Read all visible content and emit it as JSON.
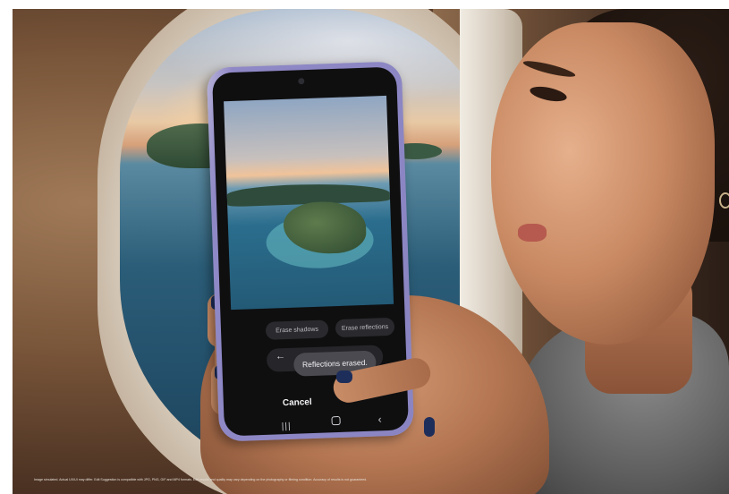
{
  "phone_ui": {
    "chips": {
      "erase_shadows": "Erase shadows",
      "erase_reflections": "Erase reflections"
    },
    "toast": "Reflections erased.",
    "back_icon": "back-arrow-icon",
    "cancel_label": "Cancel",
    "nav_bar": {
      "recents_icon": "recents-icon",
      "home_icon": "home-icon",
      "back_icon": "back-icon"
    }
  },
  "disclaimer": "Image simulated. Actual UX/UI may differ. Edit Suggestion is compatible with JPG, PNG, GIF and MP4 formats. Edit results and quality may vary depending on the photography or filming condition. Accuracy of results is not guaranteed.",
  "colors": {
    "phone_body": "#8a85c2",
    "nail_polish": "#1d2e5b",
    "toast_bg": "#4a4a50"
  }
}
